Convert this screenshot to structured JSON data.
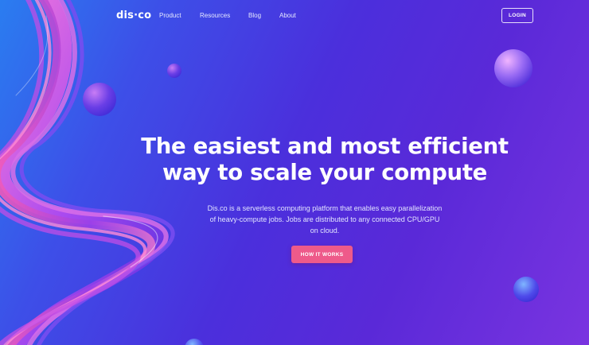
{
  "brand": {
    "logo_text": "dis·co"
  },
  "nav": {
    "items": [
      {
        "label": "Product"
      },
      {
        "label": "Resources"
      },
      {
        "label": "Blog"
      },
      {
        "label": "About"
      }
    ],
    "login_label": "LOGIN"
  },
  "hero": {
    "headline_line1": "The easiest and most efficient",
    "headline_line2": "way to scale your compute",
    "description_line1": "Dis.co is a serverless computing platform that enables easy parallelization",
    "description_line2": "of heavy-compute jobs. Jobs are distributed to any connected CPU/GPU",
    "description_line3": "on cloud.",
    "cta_label": "HOW IT WORKS"
  },
  "colors": {
    "background_start": "#2a7df0",
    "background_mid": "#4b2fdc",
    "background_end": "#7a34e0",
    "cta": "#ee5a8a",
    "ribbon_pink": "#e94fc0",
    "ribbon_purple": "#8a3ce6"
  },
  "icons": {
    "decorations": [
      "gradient-sphere",
      "ribbon-swirl"
    ]
  }
}
